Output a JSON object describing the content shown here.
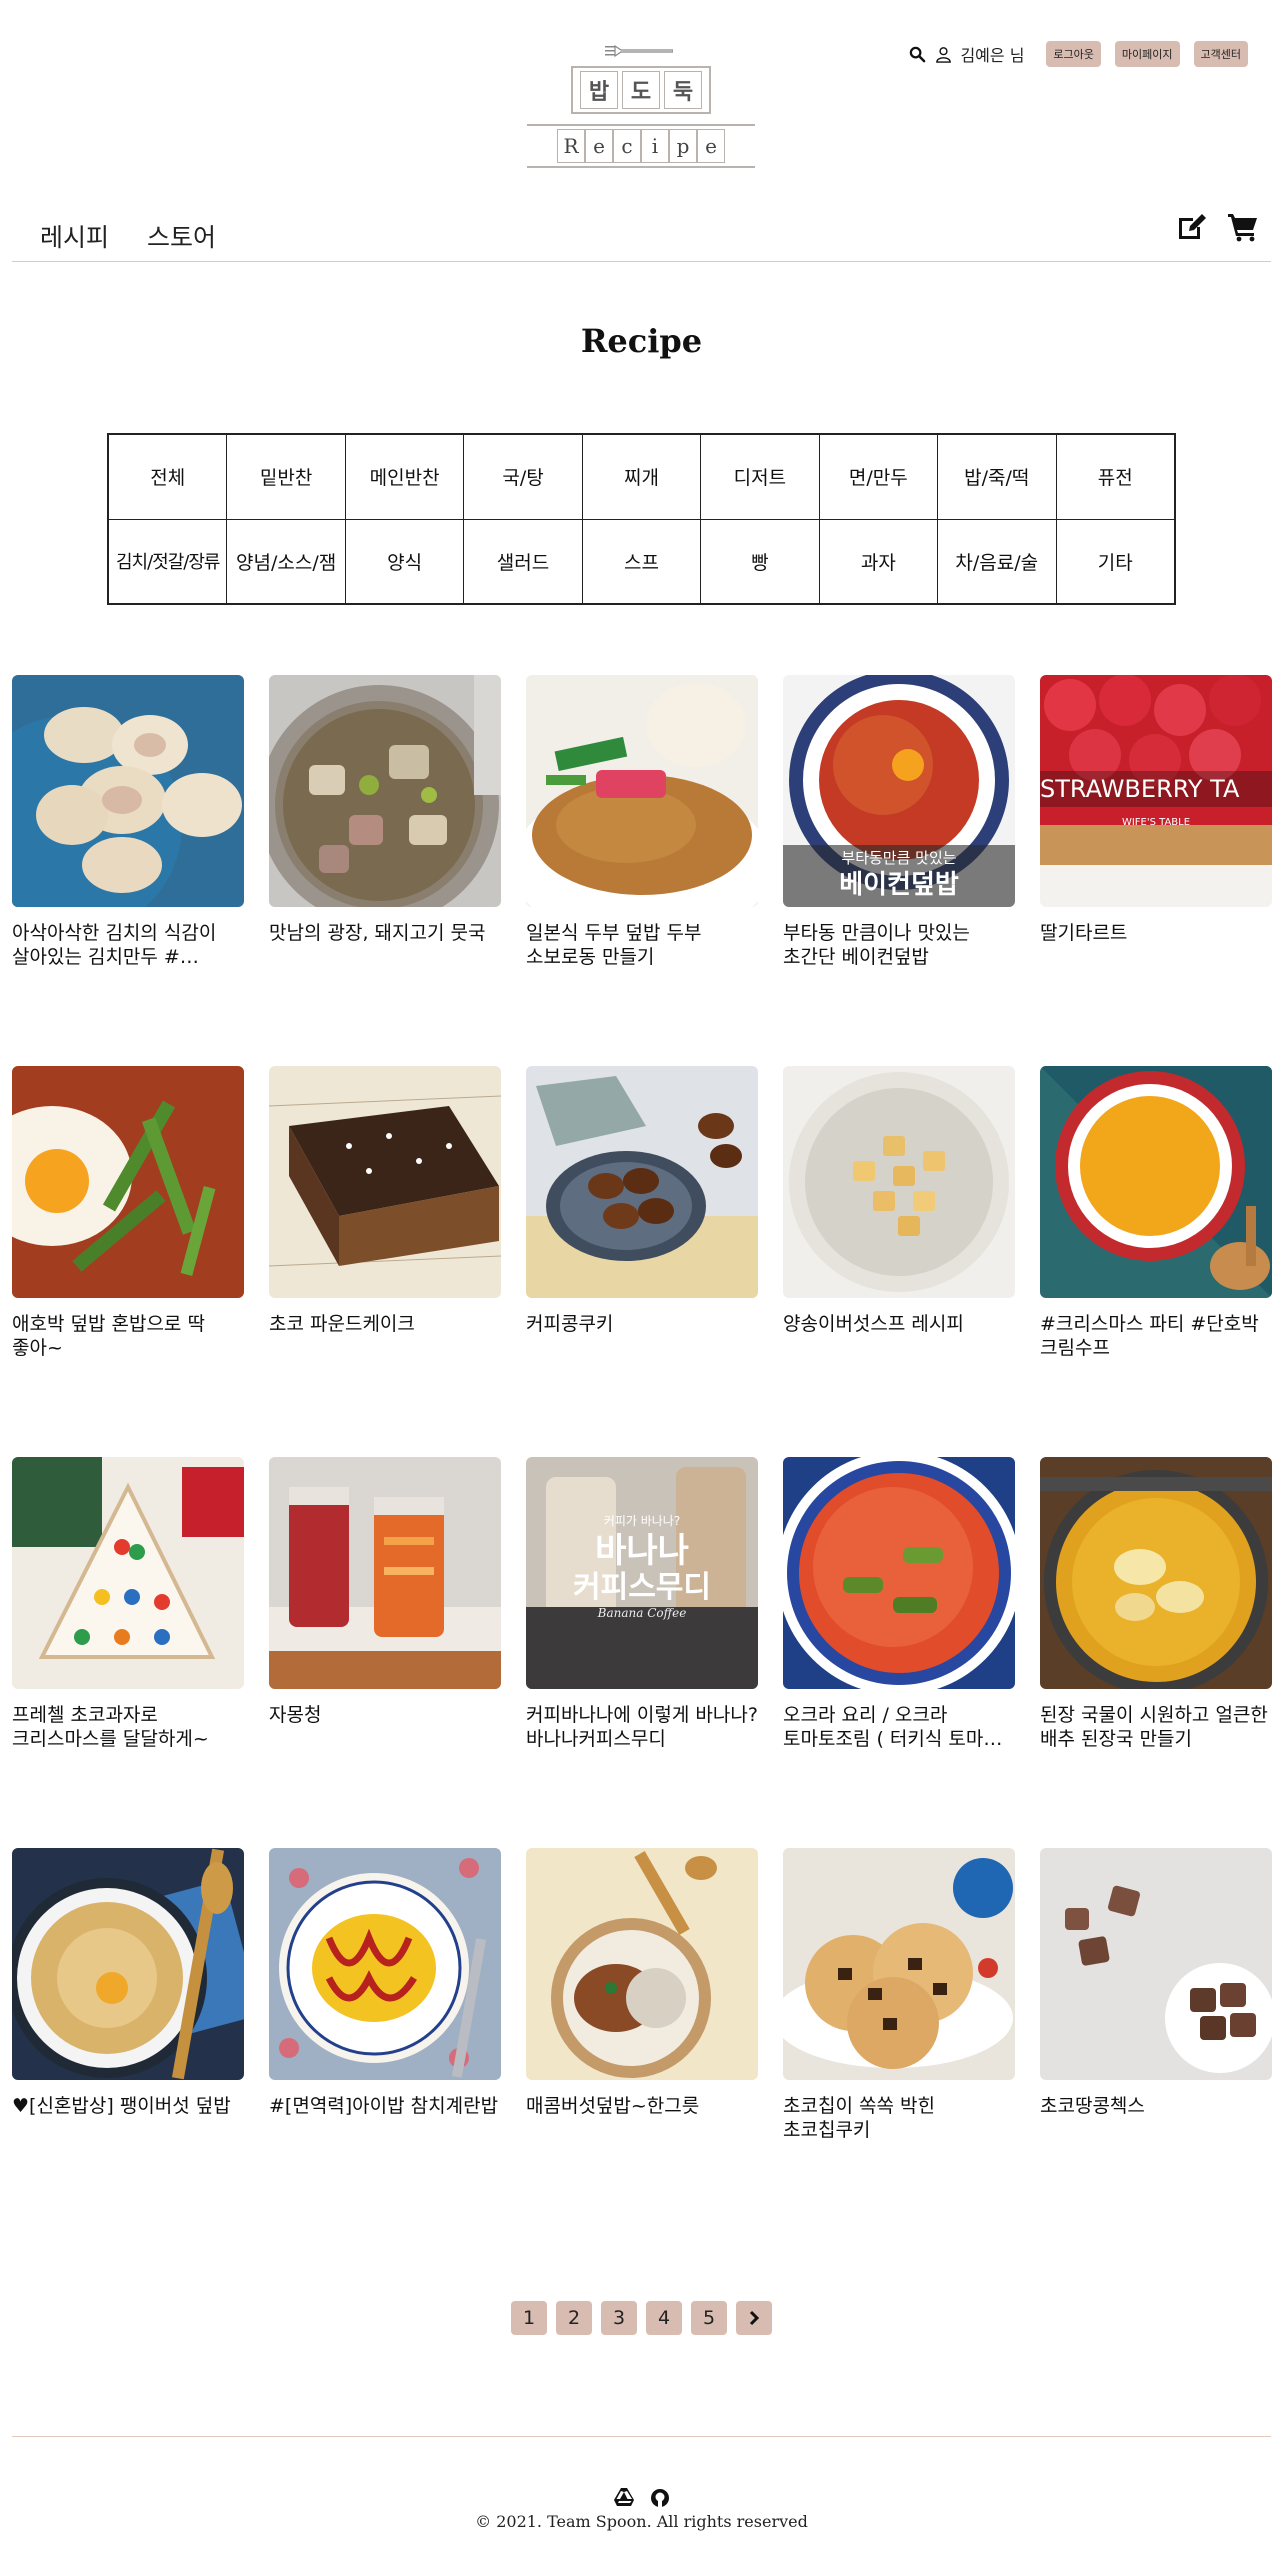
{
  "logo": {
    "top_chars": [
      "밥",
      "도",
      "둑"
    ],
    "bottom_chars": [
      "R",
      "e",
      "c",
      "i",
      "p",
      "e"
    ]
  },
  "util": {
    "username": "김예은 님",
    "buttons": [
      "로그아웃",
      "마이페이지",
      "고객센터"
    ]
  },
  "nav": {
    "items": [
      "레시피",
      "스토어"
    ]
  },
  "page_title": "Recipe",
  "categories": {
    "row1": [
      "전체",
      "밑반찬",
      "메인반찬",
      "국/탕",
      "찌개",
      "디저트",
      "면/만두",
      "밥/죽/떡",
      "퓨전"
    ],
    "row2": [
      "김치/젓갈/장류",
      "양념/소스/잼",
      "양식",
      "샐러드",
      "스프",
      "빵",
      "과자",
      "차/음료/술",
      "기타"
    ]
  },
  "recipes": [
    {
      "title": "아삭아삭한 김치의 식감이 살아있는 김치만두 #친정엄마레시피",
      "thumb": "dumplings"
    },
    {
      "title": "맛남의 광장, 돼지고기 뭇국",
      "thumb": "soup-pot"
    },
    {
      "title": "일본식 두부 덮밥 두부 소보로동 만들기",
      "thumb": "tofu-bowl"
    },
    {
      "title": "부타동 만큼이나 맛있는 초간단 베이컨덮밥",
      "thumb": "bacon-bowl"
    },
    {
      "title": "딸기타르트",
      "thumb": "strawberry-tart"
    },
    {
      "title": "애호박 덮밥 혼밥으로 딱 좋아~",
      "thumb": "zucchini-rice"
    },
    {
      "title": "초코 파운드케이크",
      "thumb": "choco-cake"
    },
    {
      "title": "커피콩쿠키",
      "thumb": "coffee-cookies"
    },
    {
      "title": "양송이버섯스프 레시피",
      "thumb": "mushroom-soup"
    },
    {
      "title": "#크리스마스 파티 #단호박 크림수프",
      "thumb": "pumpkin-soup"
    },
    {
      "title": "프레첼 초코과자로 크리스마스를 달달하게~",
      "thumb": "pretzel-tree"
    },
    {
      "title": "자몽청",
      "thumb": "grapefruit-jar"
    },
    {
      "title": "커피바나나에 이렇게 바나나? 바나나커피스무디",
      "thumb": "banana-smoothie"
    },
    {
      "title": "오크라 요리 / 오크라 토마토조림 ( 터키식 토마토 오크라 )",
      "thumb": "okra-stew"
    },
    {
      "title": "된장 국물이 시원하고 얼큰한 배추 된장국 만들기",
      "thumb": "cabbage-soup"
    },
    {
      "title": "♥[신혼밥상] 팽이버섯 덮밥",
      "thumb": "enoki-bowl"
    },
    {
      "title": "#[면역력]아이밥 참치계란밥",
      "thumb": "omurice"
    },
    {
      "title": "매콤버섯덮밥~한그릇",
      "thumb": "mushroom-rice"
    },
    {
      "title": "초코칩이 쏙쏙 박힌 초코칩쿠키",
      "thumb": "chip-cookies"
    },
    {
      "title": "초코땅콩첵스",
      "thumb": "choco-chex"
    }
  ],
  "thumb_overlays": {
    "bacon-bowl": [
      "부타동만큼 맛있는",
      "베이컨덮밥"
    ],
    "strawberry-tart": [
      "STRAWBERRY TA",
      "WIFE'S TABLE"
    ],
    "banana-smoothie": [
      "커피가 바나나?",
      "바나나",
      "커피스무디",
      "Banana Coffee"
    ]
  },
  "pagination": {
    "pages": [
      "1",
      "2",
      "3",
      "4",
      "5"
    ],
    "next": "›"
  },
  "footer": {
    "copyright": "© 2021. Team Spoon. All rights reserved"
  },
  "colors": {
    "accent": "#d8bcb1",
    "rule": "#e2c7bc"
  }
}
